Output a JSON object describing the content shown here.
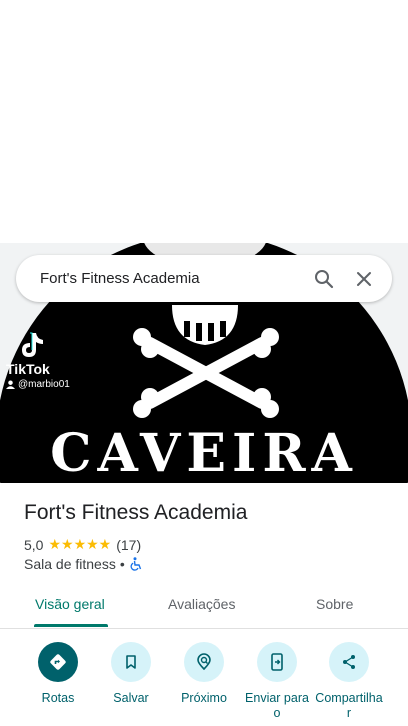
{
  "search": {
    "query": "Fort's Fitness Academia"
  },
  "hero": {
    "tiktok_brand": "TikTok",
    "tiktok_user": "@marbio01",
    "caption": "CAVEIRA"
  },
  "place": {
    "name": "Fort's Fitness Academia",
    "rating": "5,0",
    "stars": "★★★★★",
    "review_count": "(17)",
    "category": "Sala de fitness",
    "separator": "•"
  },
  "tabs": [
    {
      "label": "Visão geral",
      "active": true
    },
    {
      "label": "Avaliações",
      "active": false
    },
    {
      "label": "Sobre",
      "active": false
    }
  ],
  "actions": [
    {
      "label": "Rotas",
      "icon": "directions-icon"
    },
    {
      "label": "Salvar",
      "icon": "bookmark-icon"
    },
    {
      "label": "Próximo",
      "icon": "nearby-icon"
    },
    {
      "label": "Enviar para o",
      "icon": "send-to-phone-icon"
    },
    {
      "label": "Compartilha r",
      "icon": "share-icon"
    }
  ],
  "colors": {
    "accent": "#00796b",
    "action_bg": "#d6f3f9",
    "action_fg": "#00616b",
    "star": "#fbbc04"
  }
}
